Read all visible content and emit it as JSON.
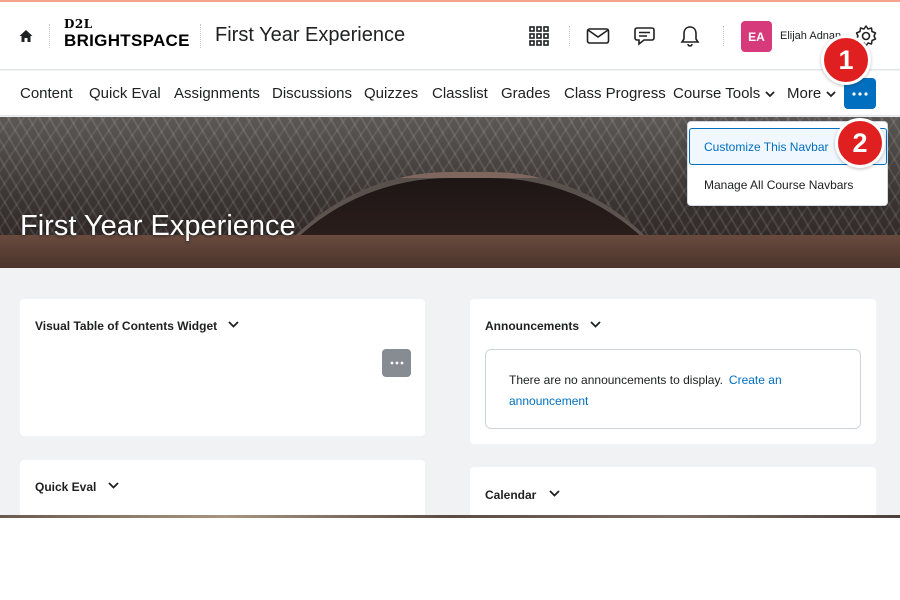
{
  "header": {
    "logo_top": "D2L",
    "logo_bottom": "BRIGHTSPACE",
    "course_title": "First Year Experience",
    "user_initials": "EA",
    "user_name": "Elijah Adnan",
    "icons": [
      "home-icon",
      "waffle-grid-icon",
      "mail-icon",
      "chat-icon",
      "bell-icon",
      "gear-icon"
    ]
  },
  "navbar": {
    "items": [
      {
        "label": "Content"
      },
      {
        "label": "Quick Eval"
      },
      {
        "label": "Assignments"
      },
      {
        "label": "Discussions"
      },
      {
        "label": "Quizzes"
      },
      {
        "label": "Classlist"
      },
      {
        "label": "Grades"
      },
      {
        "label": "Class Progress"
      },
      {
        "label": "Course Tools"
      },
      {
        "label": "More"
      }
    ]
  },
  "hero": {
    "title": "First Year Experience"
  },
  "dropdown": {
    "items": [
      {
        "label": "Customize This Navbar"
      },
      {
        "label": "Manage All Course Navbars"
      }
    ]
  },
  "markers": [
    "1",
    "2"
  ],
  "widgets": {
    "vtoc": {
      "title": "Visual Table of Contents Widget"
    },
    "quick_eval": {
      "title": "Quick Eval"
    },
    "announcements": {
      "title": "Announcements",
      "empty_text": "There are no announcements to display.",
      "link_text": "Create an announcement"
    },
    "calendar": {
      "title": "Calendar"
    }
  },
  "colors": {
    "accent": "#006fbf",
    "avatar": "#d63a7a",
    "marker": "#e02020"
  }
}
